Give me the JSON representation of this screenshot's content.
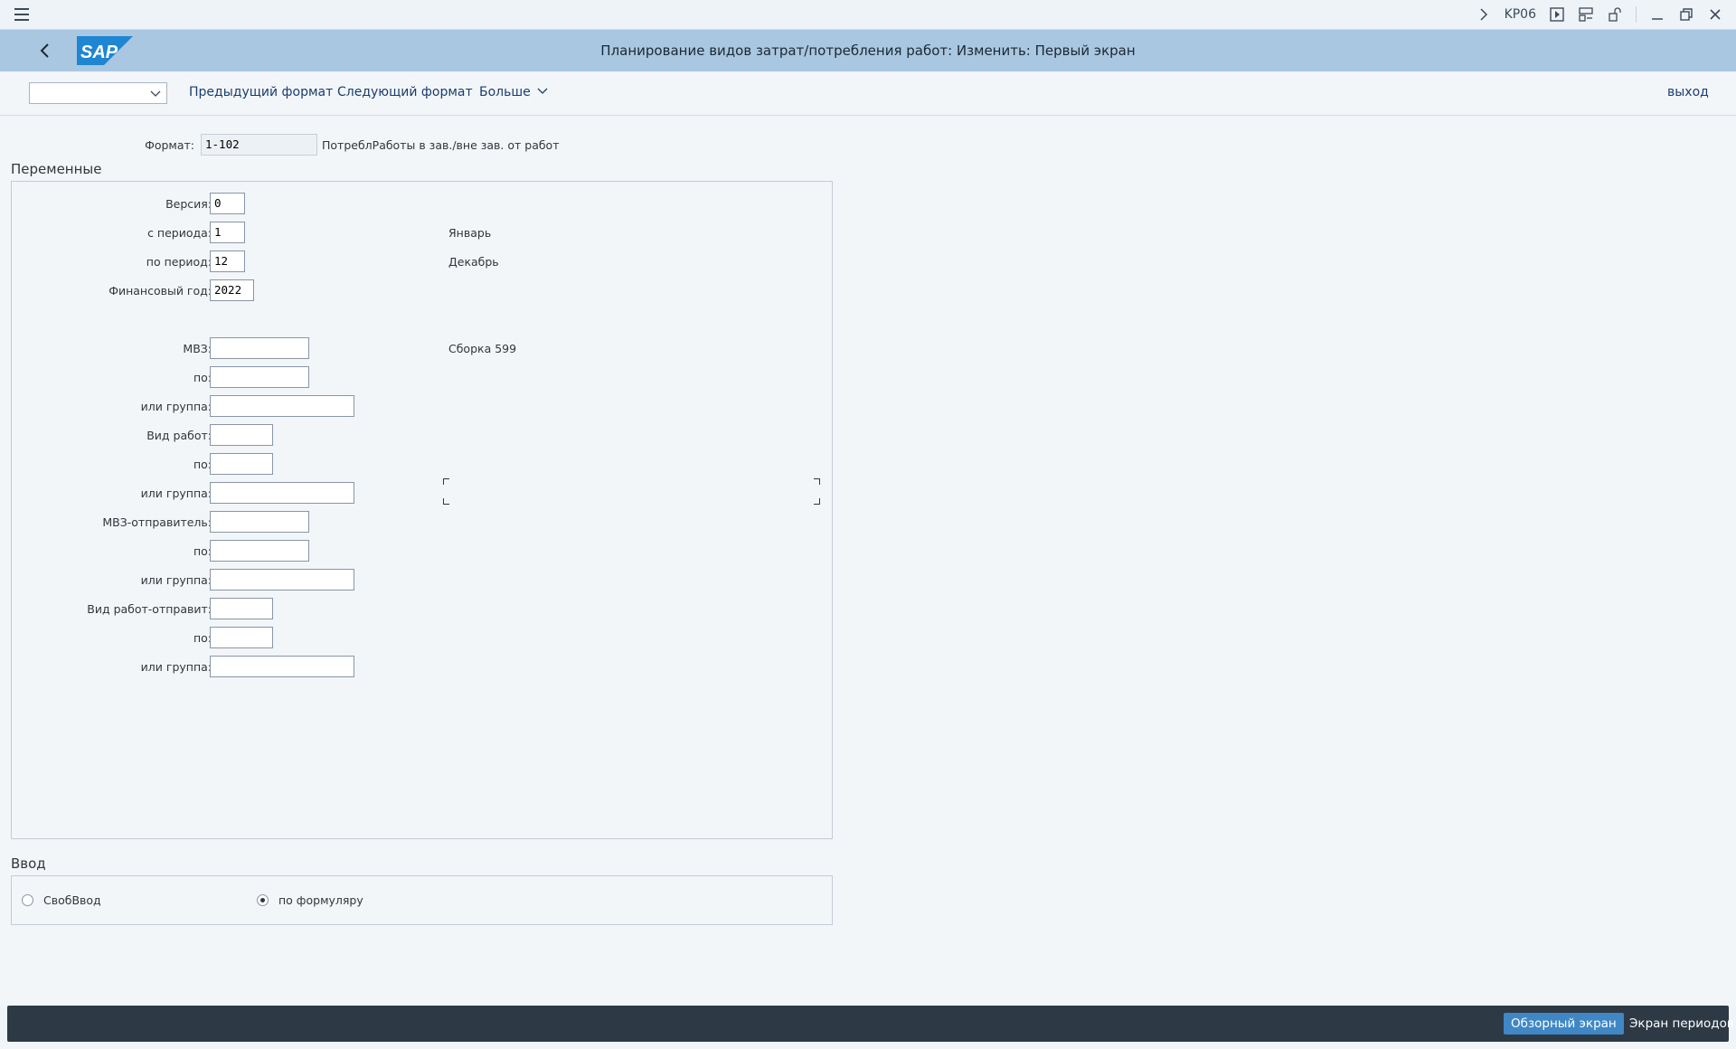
{
  "window": {
    "transaction_code": "KP06"
  },
  "header": {
    "title": "Планирование видов затрат/потребления работ: Изменить: Первый экран",
    "logo_text": "SAP"
  },
  "toolbar": {
    "dropdown_value": "",
    "prev_format": "Предыдущий формат",
    "next_format": "Следующий формат",
    "more": "Больше",
    "exit": "выход"
  },
  "format": {
    "label": "Формат:",
    "value": "1-102",
    "description": "ПотреблРаботы в зав./вне зав. от работ"
  },
  "variables": {
    "title": "Переменные",
    "version_label": "Версия:",
    "version_value": "0",
    "from_period_label": "с периода:",
    "from_period_value": "1",
    "from_period_text": "Январь",
    "to_period_label": "по период:",
    "to_period_value": "12",
    "to_period_text": "Декабрь",
    "fiscal_year_label": "Финансовый год:",
    "fiscal_year_value": "2022",
    "cc_label": "МВЗ:",
    "cc_value": "",
    "cc_text": "Сборка 599",
    "cc_to_label": "по:",
    "cc_to_value": "",
    "cc_group_label": "или группа:",
    "cc_group_value": "",
    "at_label": "Вид работ:",
    "at_value": "",
    "at_to_label": "по:",
    "at_to_value": "",
    "at_group_label": "или группа:",
    "at_group_value": "",
    "scc_label": "МВЗ-отправитель:",
    "scc_value": "",
    "scc_to_label": "по:",
    "scc_to_value": "",
    "scc_group_label": "или группа:",
    "scc_group_value": "",
    "sat_label": "Вид работ-отправит:",
    "sat_value": "",
    "sat_to_label": "по:",
    "sat_to_value": "",
    "sat_group_label": "или группа:",
    "sat_group_value": ""
  },
  "entry": {
    "title": "Ввод",
    "free_label": "СвобВвод",
    "form_label": "по формуляру",
    "selected": "form"
  },
  "footer": {
    "overview_screen": "Обзорный экран",
    "period_screen": "Экран периодов"
  },
  "colors": {
    "header_bg": "#a9c7e1",
    "sap_blue": "#1e86d3",
    "footer_bg": "#2d3a45",
    "primary_button": "#3f88c5"
  }
}
